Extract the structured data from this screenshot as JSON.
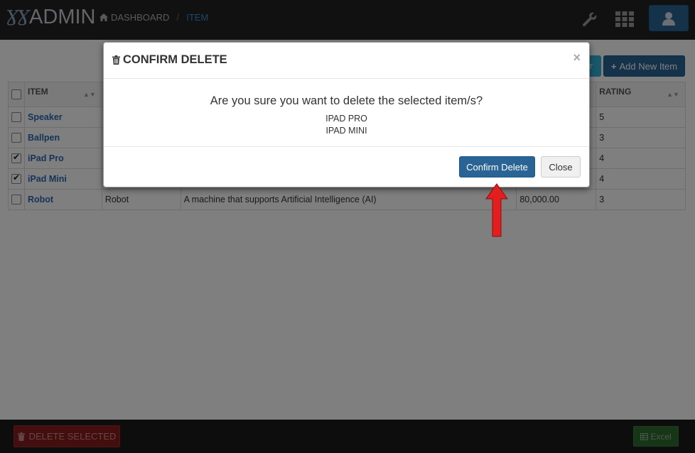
{
  "app": {
    "logo_mark": "ƔƔ",
    "logo_word": "ADMIN"
  },
  "breadcrumb": {
    "home": "DASHBOARD",
    "separator": "/",
    "current": "ITEM"
  },
  "toolbar": {
    "filter_partial": "r",
    "add_label": "Add New Item"
  },
  "table": {
    "headers": {
      "item": "ITEM",
      "rating": "RATING"
    },
    "rows": [
      {
        "name": "Speaker",
        "category": "",
        "description": "",
        "price": "",
        "rating": "5",
        "checked": false
      },
      {
        "name": "Ballpen",
        "category": "",
        "description": "",
        "price": "",
        "rating": "3",
        "checked": false
      },
      {
        "name": "iPad Pro",
        "category": "",
        "description": "",
        "price": "",
        "rating": "4",
        "checked": true
      },
      {
        "name": "iPad Mini",
        "category": "",
        "description": "",
        "price": "",
        "rating": "4",
        "checked": true
      },
      {
        "name": "Robot",
        "category": "Robot",
        "description": "A machine that supports Artificial Intelligence (AI)",
        "price": "80,000.00",
        "rating": "3",
        "checked": false
      }
    ]
  },
  "modal": {
    "title": "CONFIRM DELETE",
    "close_symbol": "×",
    "question": "Are you sure you want to delete the selected item/s?",
    "items": [
      "IPAD PRO",
      "IPAD MINI"
    ],
    "confirm_label": "Confirm Delete",
    "close_label": "Close"
  },
  "footer": {
    "delete_label": "DELETE SELECTED",
    "excel_label": "Excel"
  },
  "colors": {
    "primary": "#2a6496",
    "danger": "#8b1c1c",
    "success": "#2f6b2f",
    "navbar": "#222222",
    "arrow": "#e41e1e"
  }
}
